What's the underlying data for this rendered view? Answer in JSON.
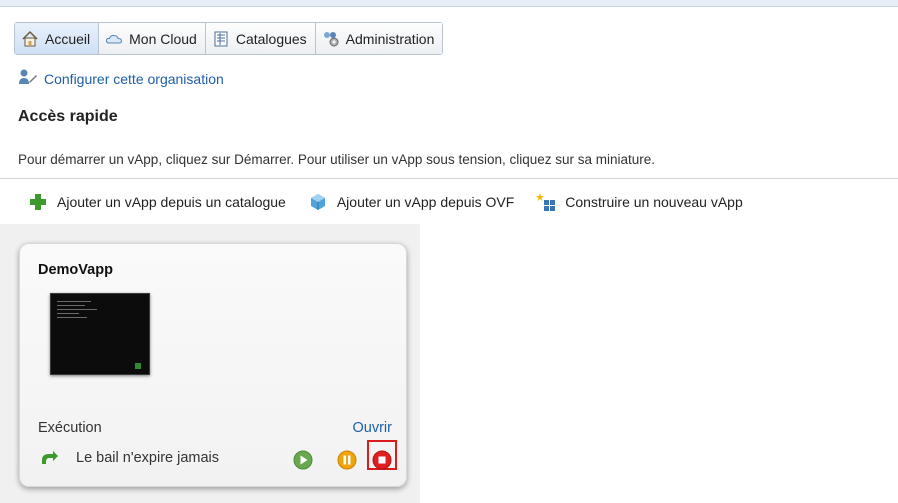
{
  "tabs": [
    {
      "label": "Accueil",
      "icon": "home-icon",
      "active": true
    },
    {
      "label": "Mon Cloud",
      "icon": "cloud-icon",
      "active": false
    },
    {
      "label": "Catalogues",
      "icon": "catalog-icon",
      "active": false
    },
    {
      "label": "Administration",
      "icon": "admin-icon",
      "active": false
    }
  ],
  "config_link": "Configurer cette organisation",
  "section_title": "Accès rapide",
  "hint_text": "Pour démarrer un vApp, cliquez sur Démarrer. Pour utiliser un vApp sous tension, cliquez sur sa miniature.",
  "actions": [
    {
      "label": "Ajouter un vApp depuis un catalogue",
      "icon": "plus-icon"
    },
    {
      "label": "Ajouter un vApp depuis OVF",
      "icon": "ovf-icon"
    },
    {
      "label": "Construire un nouveau vApp",
      "icon": "build-icon"
    }
  ],
  "vapp": {
    "name": "DemoVapp",
    "status": "Exécution",
    "open_label": "Ouvrir",
    "lease": "Le bail n'expire jamais"
  },
  "colors": {
    "link": "#1f5fa8",
    "play": "#6aa84f",
    "pause": "#f0a30a",
    "stop": "#e02020",
    "highlight": "#d81b1b"
  }
}
